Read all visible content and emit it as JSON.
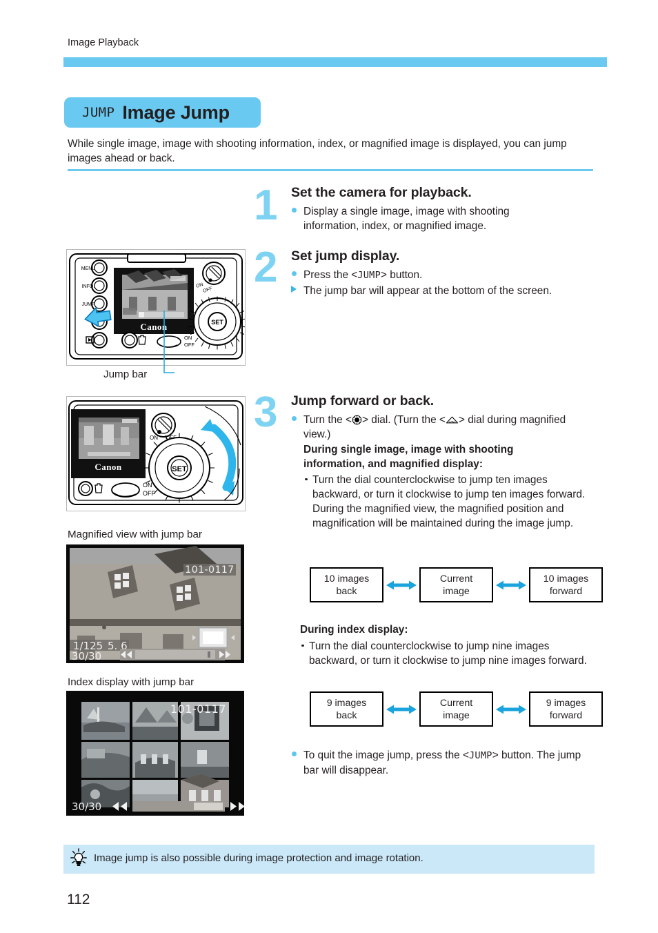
{
  "running_head": "Image Playback",
  "title": {
    "icon_label": "JUMP",
    "text": "Image Jump"
  },
  "intro": "While single image, image with shooting information, index, or magnified image is displayed, you can jump images ahead or back.",
  "colors": {
    "accent": "#6ac9f1",
    "step_number": "#7fd3f2",
    "tip_bg": "#cbe8f8",
    "bullet_dot": "#5cc6ee",
    "arrow": "#1aa3dd"
  },
  "steps": [
    {
      "number": "1",
      "title": "Set the camera for playback.",
      "bullets": [
        {
          "marker": "dot",
          "text": "Display a single image, image with shooting information, index, or magnified image."
        }
      ]
    },
    {
      "number": "2",
      "title": "Set jump display.",
      "bullets": [
        {
          "marker": "dot",
          "pre": "Press the <",
          "key": "JUMP",
          "post": ">  button."
        },
        {
          "marker": "triangle",
          "text": "The jump bar will appear at the bottom of the screen."
        }
      ]
    },
    {
      "number": "3",
      "title": "Jump forward or back.",
      "bullets": [
        {
          "marker": "dot",
          "pre": "Turn the <",
          "key_icon": "quick-control-dial",
          "mid": "> dial. (Turn the <",
          "key_icon2": "main-dial",
          "post": "> dial during magnified view.)"
        }
      ],
      "bold_heading_1": "During single image, image with shooting information, and magnified display:",
      "sub_1": "Turn the dial counterclockwise to jump ten images backward, or turn it clockwise to jump ten images forward. During the magnified view, the magnified position and magnification will be maintained during the image jump.",
      "bold_heading_2": "During index display:",
      "sub_2": "Turn the dial counterclockwise to jump nine images backward, or turn it clockwise to jump nine images forward.",
      "quit_bullet": {
        "marker": "dot",
        "pre": "To quit the image jump, press the <",
        "key": "JUMP",
        "post": ">  button. The jump bar will disappear."
      }
    }
  ],
  "flow_single": {
    "back": {
      "line1": "10 images",
      "line2": "back"
    },
    "current": {
      "line1": "Current",
      "line2": "image"
    },
    "forward": {
      "line1": "10 images",
      "line2": "forward"
    }
  },
  "flow_index": {
    "back": {
      "line1": "9 images",
      "line2": "back"
    },
    "current": {
      "line1": "Current",
      "line2": "image"
    },
    "forward": {
      "line1": "9 images",
      "line2": "forward"
    }
  },
  "figures": {
    "camera_back": {
      "caption": "Jump bar",
      "button_labels": [
        "MENU",
        "INFO.",
        "JUMP"
      ],
      "brand": "Canon",
      "power_on": "ON",
      "power_off": "OFF",
      "set_label": "SET"
    },
    "camera_dial": {
      "brand": "Canon",
      "power_on": "ON",
      "power_off": "OFF",
      "set_label": "SET"
    },
    "magnified": {
      "caption": "Magnified view with jump bar",
      "file_number": "101-0117",
      "shutter": "1/125",
      "aperture": "5. 6",
      "counter": "30/30"
    },
    "index": {
      "caption": "Index display with jump bar",
      "file_number": "101-0117",
      "counter": "30/30"
    }
  },
  "tip": {
    "icon": "lightbulb-icon",
    "text": "Image jump is also possible during image protection and image rotation."
  },
  "page_number": "112"
}
